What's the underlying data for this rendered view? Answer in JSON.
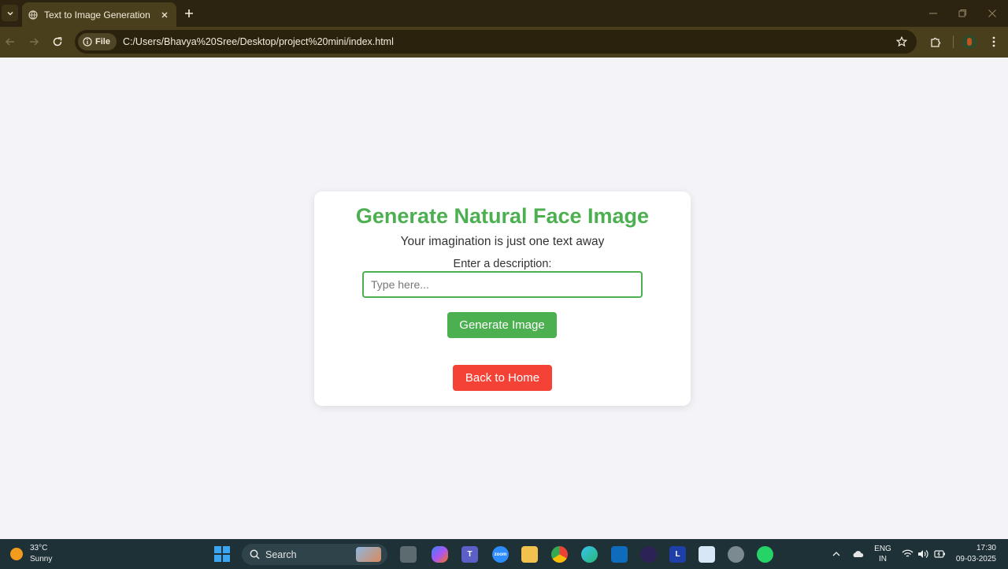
{
  "browser": {
    "tab_title": "Text to Image Generation",
    "site_chip_label": "File",
    "url": "C:/Users/Bhavya%20Sree/Desktop/project%20mini/index.html"
  },
  "page": {
    "title": "Generate Natural Face Image",
    "subtitle": "Your imagination is just one text away",
    "description_label": "Enter a description:",
    "description_placeholder": "Type here...",
    "description_value": "",
    "generate_button": "Generate Image",
    "back_button": "Back to Home"
  },
  "colors": {
    "accent_green": "#4caf50",
    "danger_red": "#f44336",
    "page_background": "#f4f4f8"
  },
  "taskbar": {
    "weather_temp": "33°C",
    "weather_condition": "Sunny",
    "search_label": "Search",
    "apps": [
      "file-explorer-icon",
      "copilot-icon",
      "teams-icon",
      "zoom-icon",
      "folder-icon",
      "chrome-icon",
      "edge-icon",
      "outlook-icon",
      "eclipse-icon",
      "l-app-icon",
      "notepad-icon",
      "settings-icon",
      "whatsapp-icon"
    ],
    "zoom_label": "zoom",
    "l_app_label": "L",
    "lang_top": "ENG",
    "lang_bottom": "IN",
    "time": "17:30",
    "date": "09-03-2025"
  }
}
